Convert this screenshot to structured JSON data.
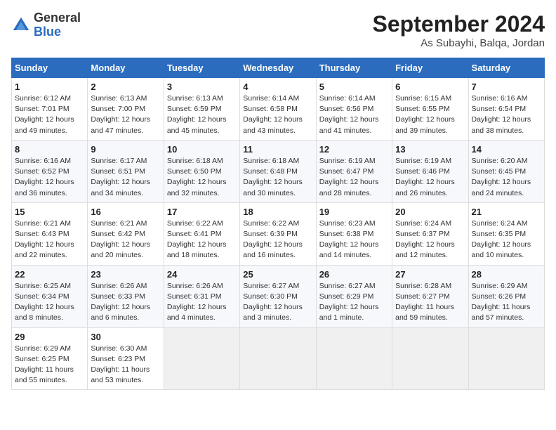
{
  "header": {
    "logo_general": "General",
    "logo_blue": "Blue",
    "month_title": "September 2024",
    "location": "As Subayhi, Balqa, Jordan"
  },
  "calendar": {
    "days_of_week": [
      "Sunday",
      "Monday",
      "Tuesday",
      "Wednesday",
      "Thursday",
      "Friday",
      "Saturday"
    ],
    "weeks": [
      [
        {
          "day": "1",
          "info": "Sunrise: 6:12 AM\nSunset: 7:01 PM\nDaylight: 12 hours\nand 49 minutes."
        },
        {
          "day": "2",
          "info": "Sunrise: 6:13 AM\nSunset: 7:00 PM\nDaylight: 12 hours\nand 47 minutes."
        },
        {
          "day": "3",
          "info": "Sunrise: 6:13 AM\nSunset: 6:59 PM\nDaylight: 12 hours\nand 45 minutes."
        },
        {
          "day": "4",
          "info": "Sunrise: 6:14 AM\nSunset: 6:58 PM\nDaylight: 12 hours\nand 43 minutes."
        },
        {
          "day": "5",
          "info": "Sunrise: 6:14 AM\nSunset: 6:56 PM\nDaylight: 12 hours\nand 41 minutes."
        },
        {
          "day": "6",
          "info": "Sunrise: 6:15 AM\nSunset: 6:55 PM\nDaylight: 12 hours\nand 39 minutes."
        },
        {
          "day": "7",
          "info": "Sunrise: 6:16 AM\nSunset: 6:54 PM\nDaylight: 12 hours\nand 38 minutes."
        }
      ],
      [
        {
          "day": "8",
          "info": "Sunrise: 6:16 AM\nSunset: 6:52 PM\nDaylight: 12 hours\nand 36 minutes."
        },
        {
          "day": "9",
          "info": "Sunrise: 6:17 AM\nSunset: 6:51 PM\nDaylight: 12 hours\nand 34 minutes."
        },
        {
          "day": "10",
          "info": "Sunrise: 6:18 AM\nSunset: 6:50 PM\nDaylight: 12 hours\nand 32 minutes."
        },
        {
          "day": "11",
          "info": "Sunrise: 6:18 AM\nSunset: 6:48 PM\nDaylight: 12 hours\nand 30 minutes."
        },
        {
          "day": "12",
          "info": "Sunrise: 6:19 AM\nSunset: 6:47 PM\nDaylight: 12 hours\nand 28 minutes."
        },
        {
          "day": "13",
          "info": "Sunrise: 6:19 AM\nSunset: 6:46 PM\nDaylight: 12 hours\nand 26 minutes."
        },
        {
          "day": "14",
          "info": "Sunrise: 6:20 AM\nSunset: 6:45 PM\nDaylight: 12 hours\nand 24 minutes."
        }
      ],
      [
        {
          "day": "15",
          "info": "Sunrise: 6:21 AM\nSunset: 6:43 PM\nDaylight: 12 hours\nand 22 minutes."
        },
        {
          "day": "16",
          "info": "Sunrise: 6:21 AM\nSunset: 6:42 PM\nDaylight: 12 hours\nand 20 minutes."
        },
        {
          "day": "17",
          "info": "Sunrise: 6:22 AM\nSunset: 6:41 PM\nDaylight: 12 hours\nand 18 minutes."
        },
        {
          "day": "18",
          "info": "Sunrise: 6:22 AM\nSunset: 6:39 PM\nDaylight: 12 hours\nand 16 minutes."
        },
        {
          "day": "19",
          "info": "Sunrise: 6:23 AM\nSunset: 6:38 PM\nDaylight: 12 hours\nand 14 minutes."
        },
        {
          "day": "20",
          "info": "Sunrise: 6:24 AM\nSunset: 6:37 PM\nDaylight: 12 hours\nand 12 minutes."
        },
        {
          "day": "21",
          "info": "Sunrise: 6:24 AM\nSunset: 6:35 PM\nDaylight: 12 hours\nand 10 minutes."
        }
      ],
      [
        {
          "day": "22",
          "info": "Sunrise: 6:25 AM\nSunset: 6:34 PM\nDaylight: 12 hours\nand 8 minutes."
        },
        {
          "day": "23",
          "info": "Sunrise: 6:26 AM\nSunset: 6:33 PM\nDaylight: 12 hours\nand 6 minutes."
        },
        {
          "day": "24",
          "info": "Sunrise: 6:26 AM\nSunset: 6:31 PM\nDaylight: 12 hours\nand 4 minutes."
        },
        {
          "day": "25",
          "info": "Sunrise: 6:27 AM\nSunset: 6:30 PM\nDaylight: 12 hours\nand 3 minutes."
        },
        {
          "day": "26",
          "info": "Sunrise: 6:27 AM\nSunset: 6:29 PM\nDaylight: 12 hours\nand 1 minute."
        },
        {
          "day": "27",
          "info": "Sunrise: 6:28 AM\nSunset: 6:27 PM\nDaylight: 11 hours\nand 59 minutes."
        },
        {
          "day": "28",
          "info": "Sunrise: 6:29 AM\nSunset: 6:26 PM\nDaylight: 11 hours\nand 57 minutes."
        }
      ],
      [
        {
          "day": "29",
          "info": "Sunrise: 6:29 AM\nSunset: 6:25 PM\nDaylight: 11 hours\nand 55 minutes."
        },
        {
          "day": "30",
          "info": "Sunrise: 6:30 AM\nSunset: 6:23 PM\nDaylight: 11 hours\nand 53 minutes."
        },
        {
          "day": "",
          "info": ""
        },
        {
          "day": "",
          "info": ""
        },
        {
          "day": "",
          "info": ""
        },
        {
          "day": "",
          "info": ""
        },
        {
          "day": "",
          "info": ""
        }
      ]
    ]
  }
}
